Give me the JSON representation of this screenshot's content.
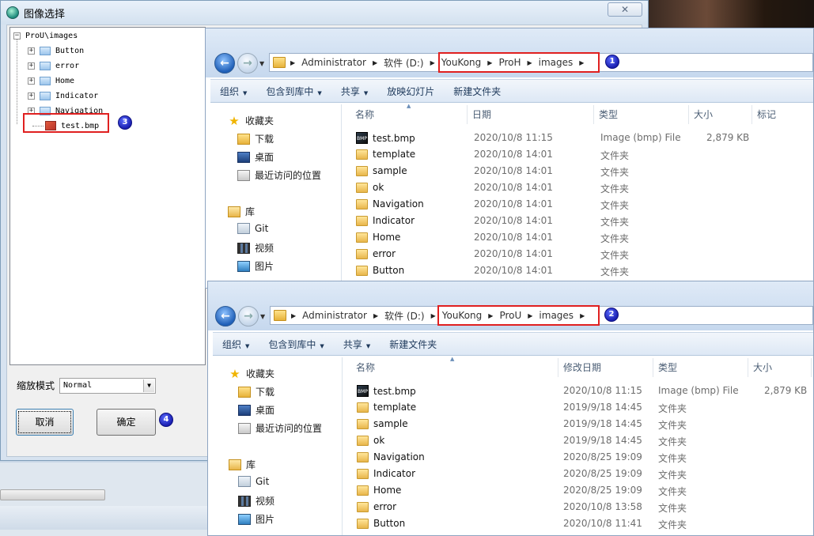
{
  "dialog": {
    "title": "图像选择",
    "tree": {
      "root": "ProU\\images",
      "children": [
        "Button",
        "error",
        "Home",
        "Indicator",
        "Navigation"
      ],
      "file": "test.bmp"
    },
    "zoom_label": "缩放模式",
    "zoom_value": "Normal",
    "cancel_label": "取消",
    "ok_label": "确定"
  },
  "badges": [
    "1",
    "2",
    "3",
    "4"
  ],
  "explorer_top": {
    "breadcrumbs": [
      "Administrator",
      "软件 (D:)",
      "YouKong",
      "ProH",
      "images"
    ],
    "toolbar": [
      "组织",
      "包含到库中",
      "共享",
      "放映幻灯片",
      "新建文件夹"
    ],
    "toolbar_dropdown": [
      true,
      true,
      true,
      false,
      false
    ],
    "nav": {
      "favorites": "收藏夹",
      "download": "下载",
      "desktop": "桌面",
      "recent": "最近访问的位置",
      "libraries": "库",
      "git": "Git",
      "video": "视频",
      "pictures": "图片"
    },
    "columns": [
      "名称",
      "日期",
      "类型",
      "大小",
      "标记"
    ],
    "rows": [
      {
        "name": "test.bmp",
        "date": "2020/10/8 11:15",
        "type": "Image (bmp) File",
        "size": "2,879 KB",
        "kind": "bmp"
      },
      {
        "name": "template",
        "date": "2020/10/8 14:01",
        "type": "文件夹",
        "size": "",
        "kind": "folder"
      },
      {
        "name": "sample",
        "date": "2020/10/8 14:01",
        "type": "文件夹",
        "size": "",
        "kind": "folder"
      },
      {
        "name": "ok",
        "date": "2020/10/8 14:01",
        "type": "文件夹",
        "size": "",
        "kind": "folder"
      },
      {
        "name": "Navigation",
        "date": "2020/10/8 14:01",
        "type": "文件夹",
        "size": "",
        "kind": "folder"
      },
      {
        "name": "Indicator",
        "date": "2020/10/8 14:01",
        "type": "文件夹",
        "size": "",
        "kind": "folder"
      },
      {
        "name": "Home",
        "date": "2020/10/8 14:01",
        "type": "文件夹",
        "size": "",
        "kind": "folder"
      },
      {
        "name": "error",
        "date": "2020/10/8 14:01",
        "type": "文件夹",
        "size": "",
        "kind": "folder"
      },
      {
        "name": "Button",
        "date": "2020/10/8 14:01",
        "type": "文件夹",
        "size": "",
        "kind": "folder"
      }
    ]
  },
  "explorer_bottom": {
    "breadcrumbs": [
      "Administrator",
      "软件 (D:)",
      "YouKong",
      "ProU",
      "images"
    ],
    "toolbar": [
      "组织",
      "包含到库中",
      "共享",
      "新建文件夹"
    ],
    "toolbar_dropdown": [
      true,
      true,
      true,
      false
    ],
    "nav": {
      "favorites": "收藏夹",
      "download": "下载",
      "desktop": "桌面",
      "recent": "最近访问的位置",
      "libraries": "库",
      "git": "Git",
      "video": "视频",
      "pictures": "图片"
    },
    "columns": [
      "名称",
      "修改日期",
      "类型",
      "大小"
    ],
    "rows": [
      {
        "name": "test.bmp",
        "date": "2020/10/8 11:15",
        "type": "Image (bmp) File",
        "size": "2,879 KB",
        "kind": "bmp"
      },
      {
        "name": "template",
        "date": "2019/9/18 14:45",
        "type": "文件夹",
        "size": "",
        "kind": "folder"
      },
      {
        "name": "sample",
        "date": "2019/9/18 14:45",
        "type": "文件夹",
        "size": "",
        "kind": "folder"
      },
      {
        "name": "ok",
        "date": "2019/9/18 14:45",
        "type": "文件夹",
        "size": "",
        "kind": "folder"
      },
      {
        "name": "Navigation",
        "date": "2020/8/25 19:09",
        "type": "文件夹",
        "size": "",
        "kind": "folder"
      },
      {
        "name": "Indicator",
        "date": "2020/8/25 19:09",
        "type": "文件夹",
        "size": "",
        "kind": "folder"
      },
      {
        "name": "Home",
        "date": "2020/8/25 19:09",
        "type": "文件夹",
        "size": "",
        "kind": "folder"
      },
      {
        "name": "error",
        "date": "2020/10/8 13:58",
        "type": "文件夹",
        "size": "",
        "kind": "folder"
      },
      {
        "name": "Button",
        "date": "2020/10/8 11:41",
        "type": "文件夹",
        "size": "",
        "kind": "folder"
      }
    ]
  },
  "colors": {
    "highlight": "#e02020",
    "badge": "#1a1fb0"
  }
}
